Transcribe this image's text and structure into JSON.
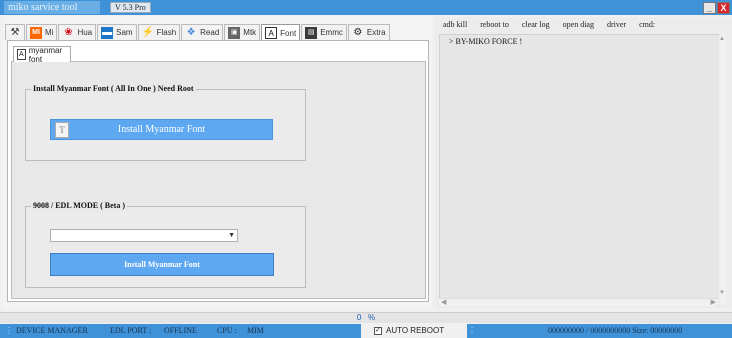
{
  "window": {
    "title": "miko sarvice tool",
    "version": "V 5.3 Pro",
    "minimize": "_",
    "close": "X"
  },
  "tabs": [
    {
      "icon": "tools-icon",
      "label": ""
    },
    {
      "icon": "mi-icon",
      "label": "Mi"
    },
    {
      "icon": "huawei-icon",
      "label": "Hua"
    },
    {
      "icon": "samsung-icon",
      "label": "Sam"
    },
    {
      "icon": "flash-icon",
      "label": "Flash"
    },
    {
      "icon": "read-icon",
      "label": "Read"
    },
    {
      "icon": "mtk-icon",
      "label": "Mtk"
    },
    {
      "icon": "font-icon",
      "label": "Font",
      "active": true
    },
    {
      "icon": "emmc-icon",
      "label": "Emmc"
    },
    {
      "icon": "extra-icon",
      "label": "Extra"
    }
  ],
  "subtab": {
    "label": "myanmar font"
  },
  "font_group": {
    "title": "Install Myanmar Font ( All In One ) Need Root",
    "button": "Install Myanmar Font"
  },
  "edl_group": {
    "title": "9008 / EDL MODE ( Beta )",
    "select_value": "",
    "button": "Install Myanmar Font"
  },
  "toolbar": [
    "adb kill",
    "reboot to",
    "clear log",
    "open diag",
    "driver",
    "cmd:"
  ],
  "log": {
    "line": "> BY-MIKO FORCE !"
  },
  "progress": {
    "value": "0",
    "unit": "%"
  },
  "status": {
    "device_manager": "DEVICE MANAGER",
    "edl_port_label": "EDL PORT :",
    "edl_port_value": "OFFLINE",
    "cpu_label": "CPU :",
    "cpu_value": "MIM",
    "auto_reboot": "AUTO REBOOT",
    "auto_reboot_checked": true,
    "size": "000000000 / 0000000000 Size: 00000000"
  }
}
